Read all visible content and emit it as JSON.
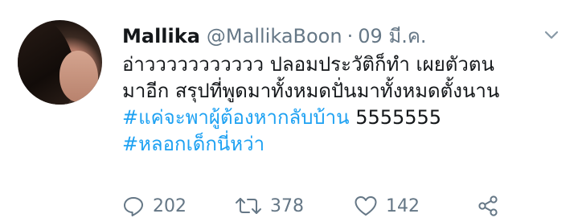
{
  "tweet": {
    "author": {
      "name": "Mallika",
      "handle": "@MallikaBoon",
      "separator": "·",
      "date": "09 มี.ค."
    },
    "body": {
      "line1": "อ่าววววววววววว ปลอมประวัติก็ทำ  เผยตัวตน",
      "line2": "มาอีก สรุปที่พูดมาทั้งหมดปั่นมาทั้งหมดตั้งนาน",
      "hashtag1": "#แค่จะพาผู้ต้องหากลับบ้าน",
      "after_hashtag1": " 5555555",
      "hashtag2": "#หลอกเด็กนี่หว่า"
    },
    "actions": {
      "replies": "202",
      "retweets": "378",
      "likes": "142"
    },
    "icons": {
      "reply": "reply-icon",
      "retweet": "retweet-icon",
      "like": "heart-icon",
      "share": "share-icon",
      "menu": "chevron-down-icon"
    },
    "colors": {
      "text": "#14171a",
      "muted": "#657786",
      "hashtag": "#1da1f2"
    }
  }
}
